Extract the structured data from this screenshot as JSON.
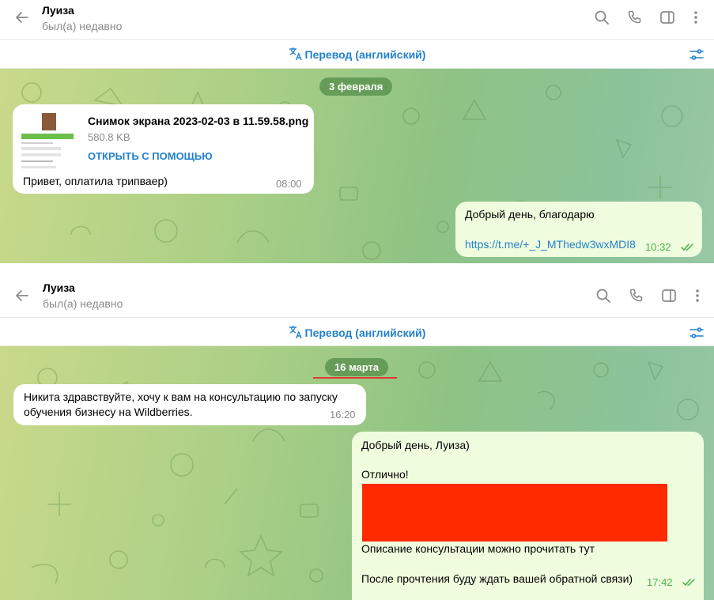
{
  "chat": {
    "name": "Луиза",
    "status": "был(а) недавно",
    "translate_label": "Перевод (английский)"
  },
  "icons": {
    "back": "arrow-left-icon",
    "search": "search-icon",
    "call": "phone-icon",
    "sidebar": "sidebar-toggle-icon",
    "more": "more-vertical-icon",
    "translate": "translate-icon",
    "settings": "sliders-icon"
  },
  "colors": {
    "accent": "#2481cc",
    "outgoing_bubble": "#effdde",
    "outgoing_time": "#4fae4e",
    "date_pill": "#5c9450",
    "redaction": "#ff2a00",
    "underline": "#e53935"
  },
  "panel1": {
    "date": "3 февраля",
    "messages": [
      {
        "direction": "in",
        "file_name": "Снимок экрана 2023-02-03 в 11.59.58.png",
        "file_size": "580.8 KB",
        "action": "ОТКРЫТЬ С ПОМОЩЬЮ",
        "text": "Привет, оплатила трипваер)",
        "time": "08:00"
      },
      {
        "direction": "out",
        "text": "Добрый день, благодарю",
        "link": "https://t.me/+_J_MThedw3wxMDI8",
        "time": "10:32",
        "read": true
      }
    ]
  },
  "panel2": {
    "date": "16 марта",
    "messages": [
      {
        "direction": "in",
        "line1": "Никита здравствуйте, хочу к вам на консультацию по запуску",
        "line2": "обучения бизнесу на Wildberries.",
        "time": "16:20"
      },
      {
        "direction": "out",
        "line1": "Добрый день, Луиза)",
        "line2": "Отлично!",
        "line3": "Описание консультации можно прочитать тут",
        "line4": "После прочтения буду ждать вашей обратной связи)",
        "time": "17:42",
        "read": true
      }
    ]
  }
}
